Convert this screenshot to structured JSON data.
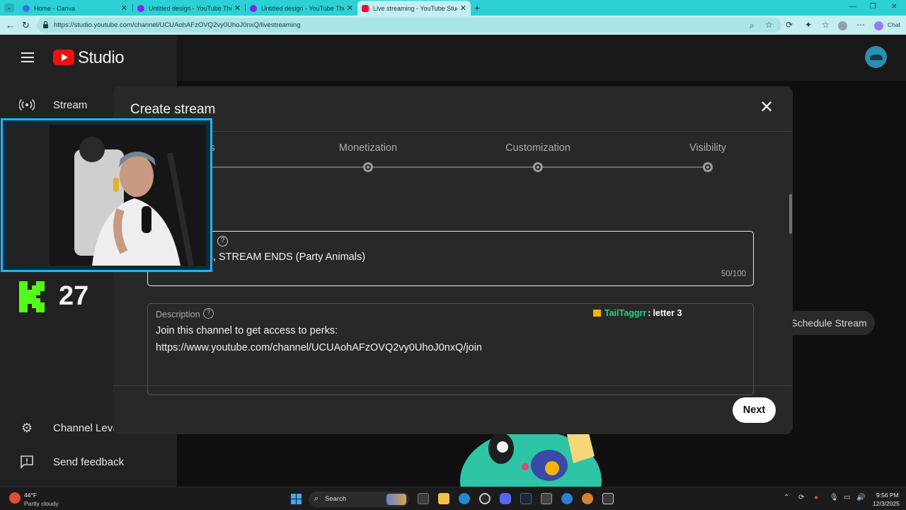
{
  "browser": {
    "tabs": [
      {
        "title": "Home - Canva",
        "favicon_color": "#3b6cf0",
        "active": false
      },
      {
        "title": "Untitled design - YouTube Thumb",
        "favicon_color": "#7d2ae8",
        "active": false
      },
      {
        "title": "Untitled design - YouTube Thumb",
        "favicon_color": "#7d2ae8",
        "active": false
      },
      {
        "title": "Live streaming - YouTube Studio",
        "favicon_color": "#ff0033",
        "active": true
      }
    ],
    "url": "https://studio.youtube.com/channel/UCUAohAFzOVQ2vy0UhoJ0nxQ/livestreaming",
    "chat_label": "Chat"
  },
  "studio": {
    "brand": "Studio",
    "sidebar": {
      "top_item": "Stream",
      "bottom_items": [
        {
          "label": "Channel Leve",
          "icon": "gear-icon"
        },
        {
          "label": "Send feedback",
          "icon": "feedback-icon"
        }
      ]
    },
    "schedule_stream_label": "Schedule Stream",
    "overlay_counter": "27",
    "accent_kick": "#53fc18"
  },
  "dialog": {
    "title": "Create stream",
    "steps": [
      {
        "label": "s"
      },
      {
        "label": "Monetization"
      },
      {
        "label": "Customization"
      },
      {
        "label": "Visibility"
      }
    ],
    "title_field": {
      "value": "IREE TIMES, STREAM ENDS (Party Animals)",
      "count": "50/100"
    },
    "description_field": {
      "label": "Description",
      "lines": [
        "Join this channel to get access to perks:",
        "https://www.youtube.com/channel/UCUAohAFzOVQ2vy0UhoJ0nxQ/join"
      ]
    },
    "next_label": "Next"
  },
  "chat_overlay": {
    "username": "TailTaggrr",
    "separator": ":",
    "message": "letter 3",
    "username_color": "#23d18b"
  },
  "taskbar": {
    "weather_temp": "44°F",
    "weather_desc": "Partly cloudy",
    "search_label": "Search",
    "time": "9:56 PM",
    "date": "12/3/2025"
  }
}
